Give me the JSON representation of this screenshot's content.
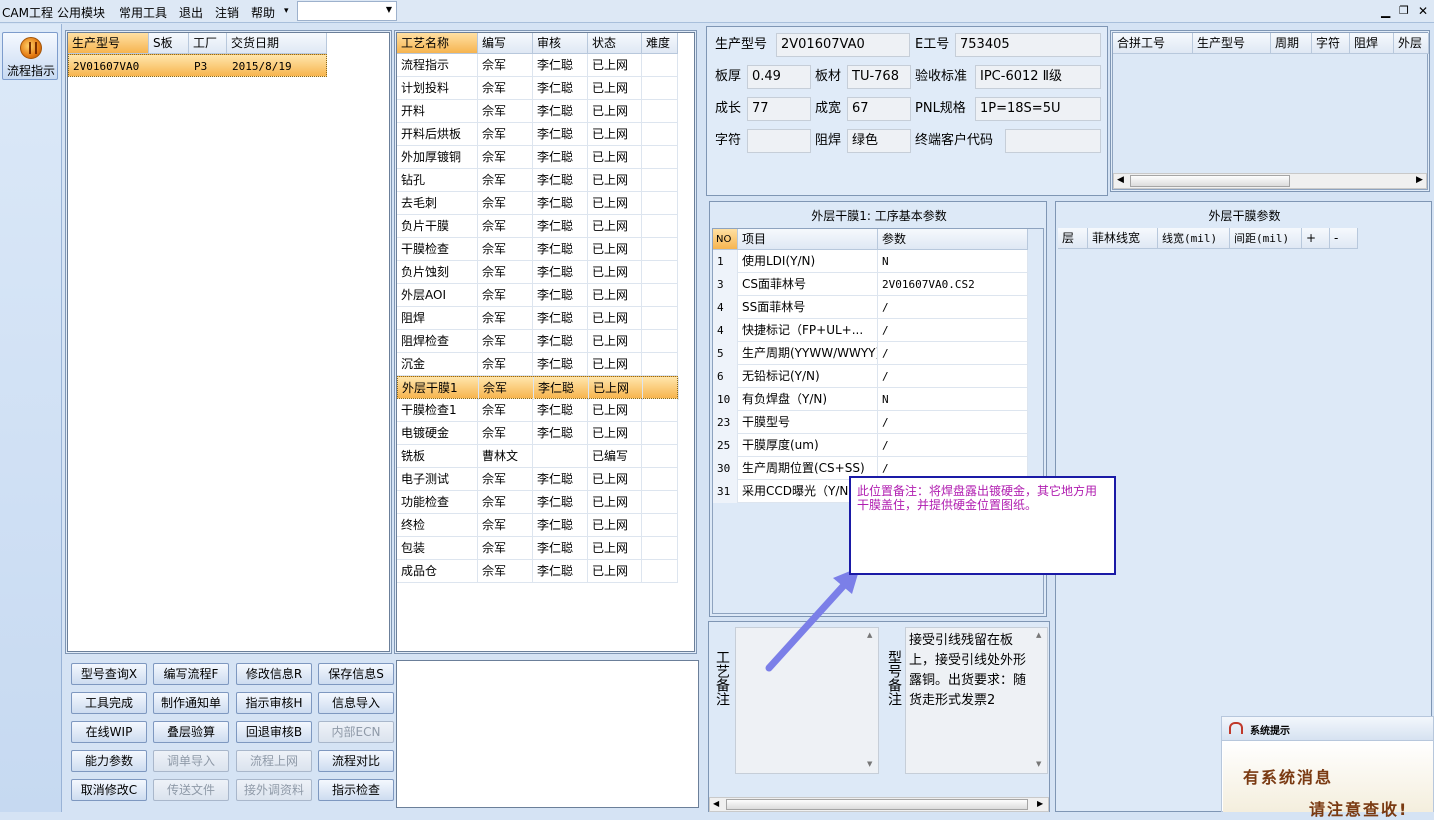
{
  "menu": {
    "items": [
      "CAM工程",
      "公用模块",
      "常用工具",
      "退出",
      "注销",
      "帮助"
    ],
    "help_arrow": "▾",
    "combo_value": "",
    "win_min": "▁",
    "win_restore": "🗗",
    "win_close": "✕"
  },
  "sidebar": {
    "flow_button_label": "流程指示"
  },
  "model_grid": {
    "headers": [
      "生产型号",
      "S板",
      "工厂",
      "交货日期"
    ],
    "rows": [
      [
        "2V01607VA0",
        "",
        "P3",
        "2015/8/19"
      ]
    ]
  },
  "process_grid": {
    "headers": [
      "工艺名称",
      "编写",
      "审核",
      "状态",
      "难度"
    ],
    "rows": [
      [
        "流程指示",
        "佘军",
        "李仁聪",
        "已上网",
        ""
      ],
      [
        "计划投料",
        "佘军",
        "李仁聪",
        "已上网",
        ""
      ],
      [
        "开料",
        "佘军",
        "李仁聪",
        "已上网",
        ""
      ],
      [
        "开料后烘板",
        "佘军",
        "李仁聪",
        "已上网",
        ""
      ],
      [
        "外加厚镀铜",
        "佘军",
        "李仁聪",
        "已上网",
        ""
      ],
      [
        "钻孔",
        "佘军",
        "李仁聪",
        "已上网",
        ""
      ],
      [
        "去毛刺",
        "佘军",
        "李仁聪",
        "已上网",
        ""
      ],
      [
        "负片干膜",
        "佘军",
        "李仁聪",
        "已上网",
        ""
      ],
      [
        "干膜检查",
        "佘军",
        "李仁聪",
        "已上网",
        ""
      ],
      [
        "负片蚀刻",
        "佘军",
        "李仁聪",
        "已上网",
        ""
      ],
      [
        "外层AOI",
        "佘军",
        "李仁聪",
        "已上网",
        ""
      ],
      [
        "阻焊",
        "佘军",
        "李仁聪",
        "已上网",
        ""
      ],
      [
        "阻焊检查",
        "佘军",
        "李仁聪",
        "已上网",
        ""
      ],
      [
        "沉金",
        "佘军",
        "李仁聪",
        "已上网",
        ""
      ],
      [
        "外层干膜1",
        "佘军",
        "李仁聪",
        "已上网",
        ""
      ],
      [
        "干膜检查1",
        "佘军",
        "李仁聪",
        "已上网",
        ""
      ],
      [
        "电镀硬金",
        "佘军",
        "李仁聪",
        "已上网",
        ""
      ],
      [
        "铣板",
        "曹林文",
        "",
        "已编写",
        ""
      ],
      [
        "电子测试",
        "佘军",
        "李仁聪",
        "已上网",
        ""
      ],
      [
        "功能检查",
        "佘军",
        "李仁聪",
        "已上网",
        ""
      ],
      [
        "终检",
        "佘军",
        "李仁聪",
        "已上网",
        ""
      ],
      [
        "包装",
        "佘军",
        "李仁聪",
        "已上网",
        ""
      ],
      [
        "成品仓",
        "佘军",
        "李仁聪",
        "已上网",
        ""
      ]
    ],
    "selected_index": 14
  },
  "buttons": [
    [
      "型号查询X",
      "编写流程F",
      "修改信息R",
      "保存信息S"
    ],
    [
      "工具完成",
      "制作通知单",
      "指示审核H",
      "信息导入"
    ],
    [
      "在线WIP",
      "叠层验算",
      "回退审核B",
      "内部ECN"
    ],
    [
      "能力参数",
      "调单导入",
      "流程上网",
      "流程对比"
    ],
    [
      "取消修改C",
      "传送文件",
      "接外调资料",
      "指示检查"
    ]
  ],
  "buttons_disabled": [
    [
      false,
      false,
      false,
      false
    ],
    [
      false,
      false,
      false,
      false
    ],
    [
      false,
      false,
      false,
      true
    ],
    [
      false,
      true,
      true,
      false
    ],
    [
      false,
      true,
      true,
      false
    ]
  ],
  "info": {
    "model_label": "生产型号",
    "model_value": "2V01607VA0",
    "e_label": "E工号",
    "e_value": "753405",
    "thickness_label": "板厚",
    "thickness_value": "0.49",
    "material_label": "板材",
    "material_value": "TU-768",
    "standard_label": "验收标准",
    "standard_value": "IPC-6012 Ⅱ级",
    "length_label": "成长",
    "length_value": "77",
    "width_label": "成宽",
    "width_value": "67",
    "pnl_label": "PNL规格",
    "pnl_value": "1P=18S=5U",
    "char_label": "字符",
    "char_value": "",
    "mask_label": "阻焊",
    "mask_value": "绿色",
    "customer_label": "终端客户代码",
    "customer_value": ""
  },
  "combine_grid": {
    "headers": [
      "合拼工号",
      "生产型号",
      "周期",
      "字符",
      "阻焊",
      "外层"
    ]
  },
  "basic_params": {
    "title": "外层干膜1: 工序基本参数",
    "headers": [
      "NO",
      "项目",
      "参数"
    ],
    "rows": [
      [
        "1",
        "使用LDI(Y/N)",
        "N"
      ],
      [
        "3",
        "CS面菲林号",
        "2V01607VA0.CS2"
      ],
      [
        "4",
        "SS面菲林号",
        "/"
      ],
      [
        "4",
        "快捷标记（FP+UL+...",
        "/"
      ],
      [
        "5",
        "生产周期(YYWW/WWYY)",
        "/"
      ],
      [
        "6",
        "无铅标记(Y/N)",
        "/"
      ],
      [
        "10",
        "有负焊盘（Y/N)",
        "N"
      ],
      [
        "23",
        "干膜型号",
        "/"
      ],
      [
        "25",
        "干膜厚度(um)",
        "/"
      ],
      [
        "30",
        "生产周期位置(CS+SS)",
        "/"
      ],
      [
        "31",
        "采用CCD曝光（Y/N",
        ""
      ]
    ]
  },
  "film_params": {
    "title": "外层干膜参数",
    "headers": [
      "层",
      "菲林线宽",
      "线宽(mil)",
      "间距(mil)",
      "+",
      "-"
    ]
  },
  "tooltip": {
    "text": "此位置备注：将焊盘露出镀硬金，其它地方用干膜盖住，并提供硬金位置图纸。"
  },
  "process_note": {
    "label": "工艺备注",
    "text": ""
  },
  "model_note": {
    "label": "型号备注",
    "text": "接受引线残留在板上，接受引线处外形露铜。出货要求：随货走形式发票2"
  },
  "system_msg": {
    "title": "系统提示",
    "line1": "有系统消息",
    "line2": "请注意查收!"
  },
  "colors": {
    "accent": "#f7b54f",
    "tooltip_border": "#1a1aa6",
    "tooltip_text": "#b01db0",
    "arrow": "#7b7fe8"
  }
}
